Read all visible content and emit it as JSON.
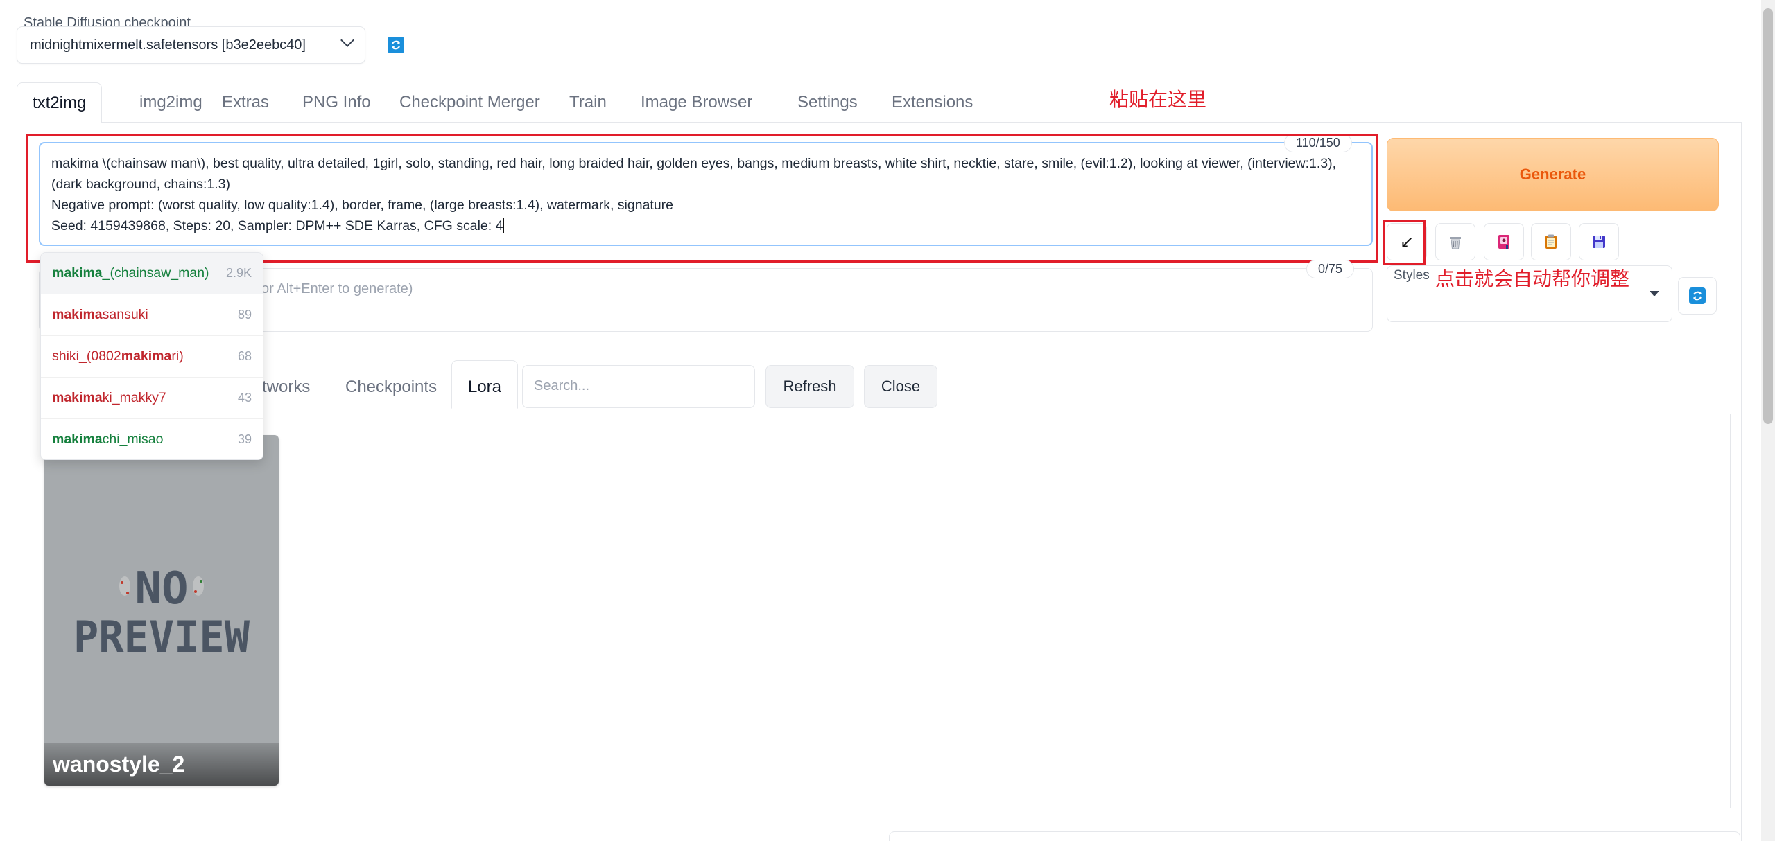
{
  "checkpoint": {
    "label": "Stable Diffusion checkpoint",
    "value": "midnightmixermelt.safetensors [b3e2eebc40]"
  },
  "tabs": [
    "txt2img",
    "img2img",
    "Extras",
    "PNG Info",
    "Checkpoint Merger",
    "Train",
    "Image Browser",
    "Settings",
    "Extensions"
  ],
  "annotations": {
    "paste_here": "粘贴在这里",
    "click_adjust": "点击就会自动帮你调整"
  },
  "prompt": {
    "line1": "makima \\(chainsaw man\\), best quality, ultra detailed, 1girl, solo, standing, red hair, long braided hair, golden eyes, bangs, medium breasts, white shirt, necktie, stare, smile, (evil:1.2), looking at viewer, (interview:1.3),",
    "line2": "(dark background, chains:1.3)",
    "line3": "Negative prompt: (worst quality, low quality:1.4), border, frame, (large breasts:1.4), watermark, signature",
    "line4": "Seed: 4159439868, Steps: 20, Sampler: DPM++ SDE Karras, CFG scale: 4",
    "counter": "110/150"
  },
  "negative": {
    "placeholder_visible": "or Alt+Enter to generate)",
    "counter": "0/75"
  },
  "generate": {
    "label": "Generate"
  },
  "tools": {
    "paste_icon": "↙",
    "trash_icon": "trash-icon",
    "extra_networks_icon": "extra-networks-icon",
    "clipboard_icon": "clipboard-icon",
    "save_icon": "save-icon"
  },
  "styles": {
    "label": "Styles"
  },
  "networks": {
    "tab_partial": "tworks",
    "checkpoints": "Checkpoints",
    "lora": "Lora",
    "search_placeholder": "Search...",
    "refresh": "Refresh",
    "close": "Close"
  },
  "card": {
    "preview_line1": "NO",
    "preview_line2": "PREVIEW",
    "title": "wanostyle_2"
  },
  "autocomplete": [
    {
      "match": "makima",
      "rest": "_(chainsaw_man)",
      "count": "2.9K",
      "color": "green",
      "prefix": ""
    },
    {
      "match": "makima",
      "rest": "sansuki",
      "count": "89",
      "color": "red",
      "prefix": ""
    },
    {
      "match": "makima",
      "rest": "ri)",
      "count": "68",
      "color": "red",
      "prefix": "shiki_(0802"
    },
    {
      "match": "makima",
      "rest": "ki_makky7",
      "count": "43",
      "color": "red",
      "prefix": ""
    },
    {
      "match": "makima",
      "rest": "chi_misao",
      "count": "39",
      "color": "green",
      "prefix": ""
    }
  ],
  "colors": {
    "accent_orange": "#ea580c",
    "annotation_red": "#e11d2a",
    "refresh_blue": "#1a8fdb"
  }
}
